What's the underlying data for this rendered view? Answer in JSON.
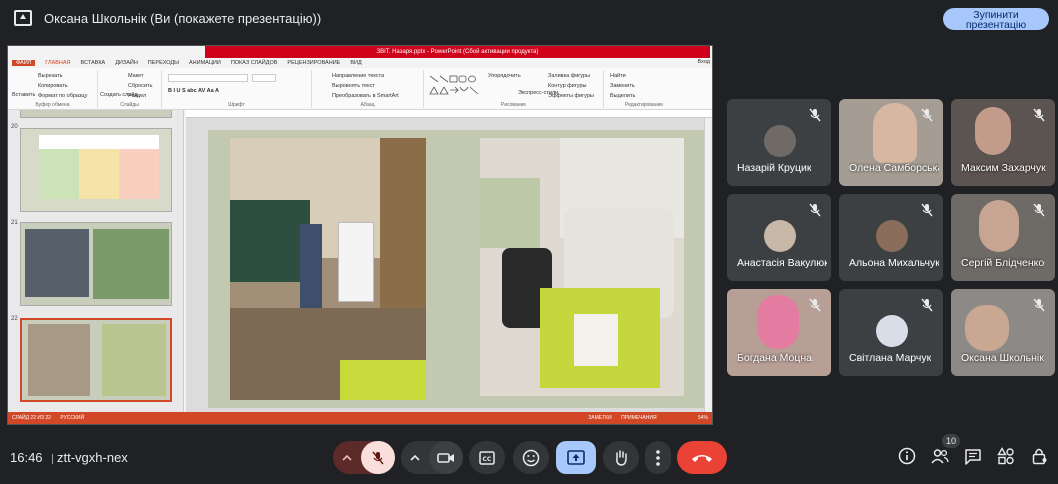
{
  "top_bar": {
    "title": "Оксана Школьнік (Ви (покажете презентацію))",
    "stop_button": "Зупинити презентацію"
  },
  "ppt": {
    "window_title": "ЗВІТ. Назаря.pptx - PowerPoint (Сбой активации продукта)",
    "tabs": [
      "ФАЙЛ",
      "ГЛАВНАЯ",
      "ВСТАВКА",
      "ДИЗАЙН",
      "ПЕРЕХОДЫ",
      "АНИМАЦИИ",
      "ПОКАЗ СЛАЙДОВ",
      "РЕЦЕНЗИРОВАНИЕ",
      "ВИД"
    ],
    "login": "Вход",
    "ribbon": {
      "paste": "Вставить",
      "cut": "Вырезать",
      "copy": "Копировать",
      "format_painter": "Формат по образцу",
      "clipboard_group": "Буфер обмена",
      "new_slide": "Создать слайд",
      "layout": "Макет",
      "reset": "Сбросить",
      "section": "Раздел",
      "slides_group": "Слайды",
      "font_group": "Шрифт",
      "text_direction": "Направление текста",
      "align_text": "Выровнять текст",
      "smartart": "Преобразовать в SmartArt",
      "paragraph_group": "Абзац",
      "arrange": "Упорядочить",
      "quick_styles": "Экспресс-стили",
      "shape_fill": "Заливка фигуры",
      "shape_outline": "Контур фигуры",
      "shape_effects": "Эффекты фигуры",
      "drawing_group": "Рисование",
      "find": "Найти",
      "replace": "Заменить",
      "select": "Выделить",
      "editing_group": "Редактирование"
    },
    "slide_numbers": [
      "20",
      "21",
      "22"
    ],
    "status_left": "СЛАЙД 22 ИЗ 22",
    "status_lang": "РУССКИЙ",
    "status_notes": "ЗАМЕТКИ",
    "status_comments": "ПРИМЕЧАНИЯ",
    "zoom": "54%"
  },
  "participants": [
    {
      "name": "Назарій Круцик",
      "muted": true
    },
    {
      "name": "Олена Самборська",
      "muted": true
    },
    {
      "name": "Максим Захарчук",
      "muted": true
    },
    {
      "name": "Анастасія Вакулюк",
      "muted": true
    },
    {
      "name": "Альона Михальчук",
      "muted": true
    },
    {
      "name": "Сергій Блідченко",
      "muted": true
    },
    {
      "name": "Богдана Моцна",
      "muted": true
    },
    {
      "name": "Світлана Марчук",
      "muted": true
    },
    {
      "name": "Оксана Школьнік",
      "muted": true
    }
  ],
  "bottom_bar": {
    "time": "16:46",
    "meeting_code": "ztt-vgxh-nex",
    "participant_count": "10"
  },
  "colors": {
    "background": "#202124",
    "tile": "#3c4043",
    "hangup": "#ea4335",
    "mic_muted_bg": "#f9dedc",
    "present_active": "#a8c7fa"
  }
}
